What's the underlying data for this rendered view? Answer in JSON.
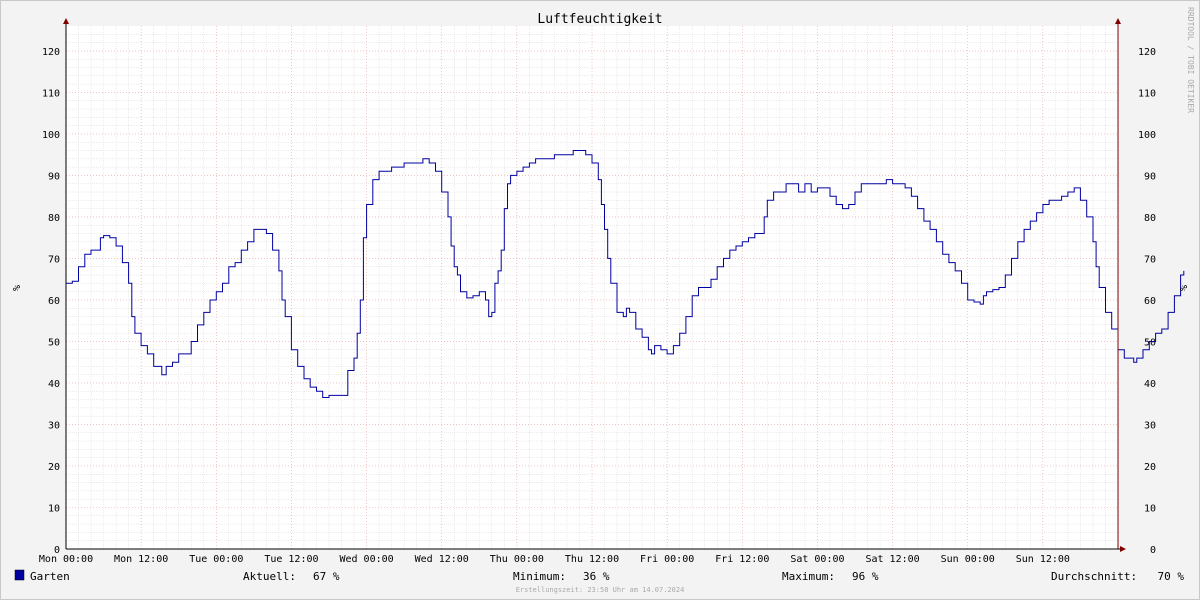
{
  "watermark": "RRDTOOL / TOBI OETIKER",
  "footer": {
    "legend_name": "Garten",
    "legend_color": "#0000a0",
    "aktuell_label": "Aktuell:",
    "aktuell_value": "67 %",
    "minimum_label": "Minimum:",
    "minimum_value": "36 %",
    "maximum_label": "Maximum:",
    "maximum_value": "96 %",
    "durchschnitt_label": "Durchschnitt:",
    "durchschnitt_value": "70 %",
    "creation_time": "Erstellungszeit: 23:58 Uhr am 14.07.2024"
  },
  "colors": {
    "background": "#f3f3f3",
    "plot_background": "#ffffff",
    "major_grid": "#e8a0a0",
    "minor_grid": "#d8d8d8",
    "axis": "#000000",
    "arrow": "#800000",
    "line": "#0000a0"
  },
  "chart_data": {
    "type": "line",
    "title": "Luftfeuchtigkeit",
    "ylabel": "%",
    "ylabel_right": "%",
    "xlabel": "",
    "ylim": [
      0,
      126
    ],
    "xlim": [
      0,
      168
    ],
    "y_ticks": [
      0,
      10,
      20,
      30,
      40,
      50,
      60,
      70,
      80,
      90,
      100,
      110,
      120
    ],
    "x_ticks": [
      {
        "hour": 0,
        "label": "Mon 00:00"
      },
      {
        "hour": 12,
        "label": "Mon 12:00"
      },
      {
        "hour": 24,
        "label": "Tue 00:00"
      },
      {
        "hour": 36,
        "label": "Tue 12:00"
      },
      {
        "hour": 48,
        "label": "Wed 00:00"
      },
      {
        "hour": 60,
        "label": "Wed 12:00"
      },
      {
        "hour": 72,
        "label": "Thu 00:00"
      },
      {
        "hour": 84,
        "label": "Thu 12:00"
      },
      {
        "hour": 96,
        "label": "Fri 00:00"
      },
      {
        "hour": 108,
        "label": "Fri 12:00"
      },
      {
        "hour": 120,
        "label": "Sat 00:00"
      },
      {
        "hour": 132,
        "label": "Sat 12:00"
      },
      {
        "hour": 144,
        "label": "Sun 00:00"
      },
      {
        "hour": 156,
        "label": "Sun 12:00"
      }
    ],
    "grid": true,
    "legend_position": "bottom-left",
    "series": [
      {
        "name": "Garten",
        "color": "#0000a0",
        "points": [
          [
            0,
            64
          ],
          [
            1,
            64.5
          ],
          [
            2,
            68
          ],
          [
            3,
            71
          ],
          [
            4,
            72
          ],
          [
            5,
            72
          ],
          [
            5.5,
            75
          ],
          [
            6,
            75.5
          ],
          [
            7,
            75
          ],
          [
            8,
            73
          ],
          [
            9,
            69
          ],
          [
            10,
            64
          ],
          [
            10.5,
            56
          ],
          [
            11,
            52
          ],
          [
            12,
            49
          ],
          [
            13,
            47
          ],
          [
            14,
            44
          ],
          [
            15,
            44
          ],
          [
            15.3,
            42
          ],
          [
            16,
            44
          ],
          [
            17,
            45
          ],
          [
            18,
            47
          ],
          [
            19,
            47
          ],
          [
            20,
            50
          ],
          [
            21,
            54
          ],
          [
            22,
            57
          ],
          [
            23,
            60
          ],
          [
            24,
            62
          ],
          [
            25,
            64
          ],
          [
            26,
            68
          ],
          [
            27,
            69
          ],
          [
            28,
            72
          ],
          [
            29,
            74
          ],
          [
            30,
            77
          ],
          [
            31,
            77
          ],
          [
            32,
            76
          ],
          [
            33,
            72
          ],
          [
            34,
            67
          ],
          [
            34.5,
            60
          ],
          [
            35,
            56
          ],
          [
            36,
            48
          ],
          [
            37,
            44
          ],
          [
            38,
            41
          ],
          [
            39,
            39
          ],
          [
            40,
            38
          ],
          [
            41,
            36.5
          ],
          [
            42,
            37
          ],
          [
            43,
            37
          ],
          [
            44,
            37
          ],
          [
            45,
            43
          ],
          [
            46,
            46
          ],
          [
            46.5,
            52
          ],
          [
            47,
            60
          ],
          [
            47.5,
            75
          ],
          [
            48,
            83
          ],
          [
            49,
            89
          ],
          [
            50,
            91
          ],
          [
            51,
            91
          ],
          [
            52,
            92
          ],
          [
            53,
            92
          ],
          [
            54,
            93
          ],
          [
            55,
            93
          ],
          [
            56,
            93
          ],
          [
            57,
            94
          ],
          [
            58,
            93
          ],
          [
            59,
            91
          ],
          [
            60,
            86
          ],
          [
            61,
            80
          ],
          [
            61.5,
            73
          ],
          [
            62,
            68
          ],
          [
            62.5,
            66
          ],
          [
            63,
            62
          ],
          [
            64,
            60.5
          ],
          [
            65,
            61
          ],
          [
            66,
            62
          ],
          [
            67,
            60
          ],
          [
            67.5,
            56
          ],
          [
            68,
            57
          ],
          [
            68.5,
            64
          ],
          [
            69,
            67
          ],
          [
            69.5,
            72
          ],
          [
            70,
            82
          ],
          [
            70.5,
            88
          ],
          [
            71,
            90
          ],
          [
            72,
            91
          ],
          [
            73,
            92
          ],
          [
            74,
            93
          ],
          [
            75,
            94
          ],
          [
            76,
            94
          ],
          [
            77,
            94
          ],
          [
            78,
            95
          ],
          [
            79,
            95
          ],
          [
            80,
            95
          ],
          [
            81,
            96
          ],
          [
            82,
            96
          ],
          [
            83,
            95
          ],
          [
            84,
            93
          ],
          [
            85,
            89
          ],
          [
            85.5,
            83
          ],
          [
            86,
            77
          ],
          [
            86.5,
            70
          ],
          [
            87,
            64
          ],
          [
            88,
            57
          ],
          [
            89,
            56
          ],
          [
            89.5,
            58
          ],
          [
            90,
            57
          ],
          [
            91,
            53
          ],
          [
            92,
            51
          ],
          [
            93,
            48
          ],
          [
            93.5,
            47
          ],
          [
            94,
            49
          ],
          [
            95,
            48
          ],
          [
            96,
            47
          ],
          [
            97,
            49
          ],
          [
            98,
            52
          ],
          [
            99,
            56
          ],
          [
            100,
            61
          ],
          [
            101,
            63
          ],
          [
            102,
            63
          ],
          [
            103,
            65
          ],
          [
            104,
            68
          ],
          [
            105,
            70
          ],
          [
            106,
            72
          ],
          [
            107,
            73
          ],
          [
            108,
            74
          ],
          [
            109,
            75
          ],
          [
            110,
            76
          ],
          [
            111,
            76
          ],
          [
            111.5,
            80
          ],
          [
            112,
            84
          ],
          [
            113,
            86
          ],
          [
            114,
            86
          ],
          [
            115,
            88
          ],
          [
            116,
            88
          ],
          [
            117,
            86
          ],
          [
            118,
            88
          ],
          [
            119,
            86
          ],
          [
            120,
            87
          ],
          [
            121,
            87
          ],
          [
            122,
            85
          ],
          [
            123,
            83
          ],
          [
            124,
            82
          ],
          [
            125,
            83
          ],
          [
            126,
            86
          ],
          [
            127,
            88
          ],
          [
            128,
            88
          ],
          [
            129,
            88
          ],
          [
            130,
            88
          ],
          [
            131,
            89
          ],
          [
            132,
            88
          ],
          [
            133,
            88
          ],
          [
            134,
            87
          ],
          [
            135,
            85
          ],
          [
            136,
            82
          ],
          [
            137,
            79
          ],
          [
            138,
            77
          ],
          [
            139,
            74
          ],
          [
            140,
            71
          ],
          [
            141,
            69
          ],
          [
            142,
            67
          ],
          [
            143,
            64
          ],
          [
            144,
            60
          ],
          [
            145,
            59.5
          ],
          [
            146,
            59
          ],
          [
            146.5,
            61
          ],
          [
            147,
            62
          ],
          [
            148,
            62.5
          ],
          [
            149,
            63
          ],
          [
            150,
            66
          ],
          [
            151,
            70
          ],
          [
            152,
            74
          ],
          [
            153,
            77
          ],
          [
            154,
            79
          ],
          [
            155,
            81
          ],
          [
            156,
            83
          ],
          [
            157,
            84
          ],
          [
            158,
            84
          ],
          [
            159,
            85
          ],
          [
            160,
            86
          ],
          [
            161,
            87
          ],
          [
            162,
            84
          ],
          [
            163,
            80
          ],
          [
            164,
            74
          ],
          [
            164.5,
            68
          ],
          [
            165,
            63
          ],
          [
            166,
            57
          ],
          [
            167,
            53
          ],
          [
            168,
            48
          ],
          [
            169,
            46
          ],
          [
            170,
            46
          ],
          [
            170.5,
            45
          ],
          [
            171,
            46
          ],
          [
            172,
            48
          ],
          [
            173,
            50
          ],
          [
            174,
            52
          ],
          [
            175,
            53
          ],
          [
            176,
            57
          ],
          [
            177,
            61
          ],
          [
            178,
            66
          ],
          [
            178.5,
            67
          ]
        ]
      }
    ]
  }
}
